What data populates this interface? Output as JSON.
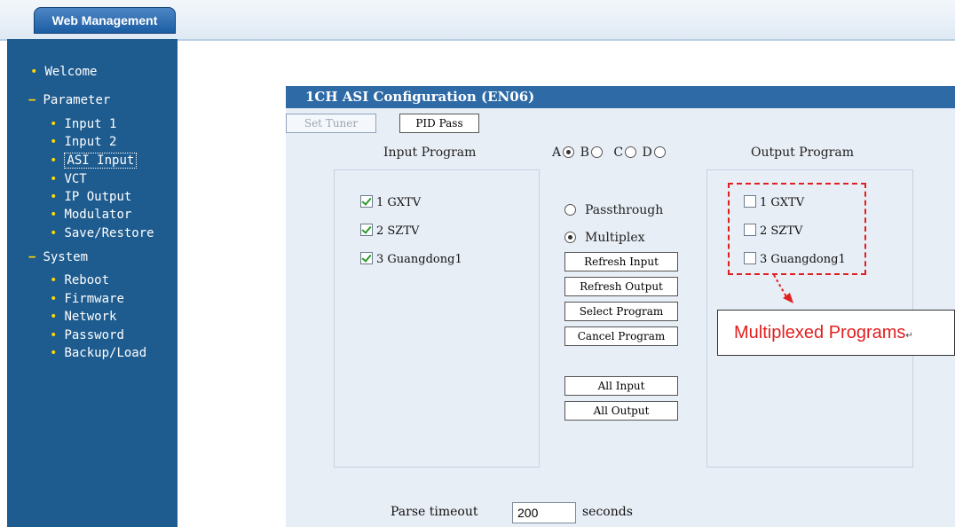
{
  "header": {
    "brand": "Web Management"
  },
  "sidebar": {
    "items": [
      {
        "label": "Welcome",
        "type": "leaf"
      },
      {
        "label": "Parameter",
        "type": "group"
      },
      {
        "label": "Input 1",
        "type": "child"
      },
      {
        "label": "Input 2",
        "type": "child"
      },
      {
        "label": "ASI Input",
        "type": "child",
        "active": true
      },
      {
        "label": "VCT",
        "type": "child"
      },
      {
        "label": "IP Output",
        "type": "child"
      },
      {
        "label": "Modulator",
        "type": "child"
      },
      {
        "label": "Save/Restore",
        "type": "child"
      },
      {
        "label": "System",
        "type": "group"
      },
      {
        "label": "Reboot",
        "type": "child"
      },
      {
        "label": "Firmware",
        "type": "child"
      },
      {
        "label": "Network",
        "type": "child"
      },
      {
        "label": "Password",
        "type": "child"
      },
      {
        "label": "Backup/Load",
        "type": "child"
      }
    ]
  },
  "panel": {
    "title": "1CH ASI Configuration (EN06)",
    "tabs": {
      "set_tuner": "Set Tuner",
      "pid_pass": "PID Pass"
    },
    "input_header": "Input Program",
    "output_header": "Output Program",
    "channels": {
      "a": "A",
      "b": "B",
      "c": "C",
      "d": "D",
      "selected": "A"
    },
    "input_programs": [
      {
        "label": "1 GXTV",
        "checked": true
      },
      {
        "label": "2 SZTV",
        "checked": true
      },
      {
        "label": "3 Guangdong1",
        "checked": true
      }
    ],
    "output_programs": [
      {
        "label": "1 GXTV",
        "checked": false
      },
      {
        "label": "2 SZTV",
        "checked": false
      },
      {
        "label": "3 Guangdong1",
        "checked": false
      }
    ],
    "modes": {
      "passthrough": "Passthrough",
      "multiplex": "Multiplex",
      "selected": "Multiplex"
    },
    "buttons": {
      "refresh_input": "Refresh Input",
      "refresh_output": "Refresh Output",
      "select_program": "Select Program",
      "cancel_program": "Cancel Program",
      "all_input": "All Input",
      "all_output": "All Output"
    },
    "timeout": {
      "label": "Parse timeout",
      "value": "200",
      "unit": "seconds"
    }
  },
  "annotation": {
    "text": "Multiplexed Programs",
    "color": "#e02020"
  },
  "colors": {
    "sidebar": "#1e5b8e",
    "title_bar": "#2d6aa6",
    "panel_bg": "#e8eef6",
    "bullet": "#ffd800"
  }
}
